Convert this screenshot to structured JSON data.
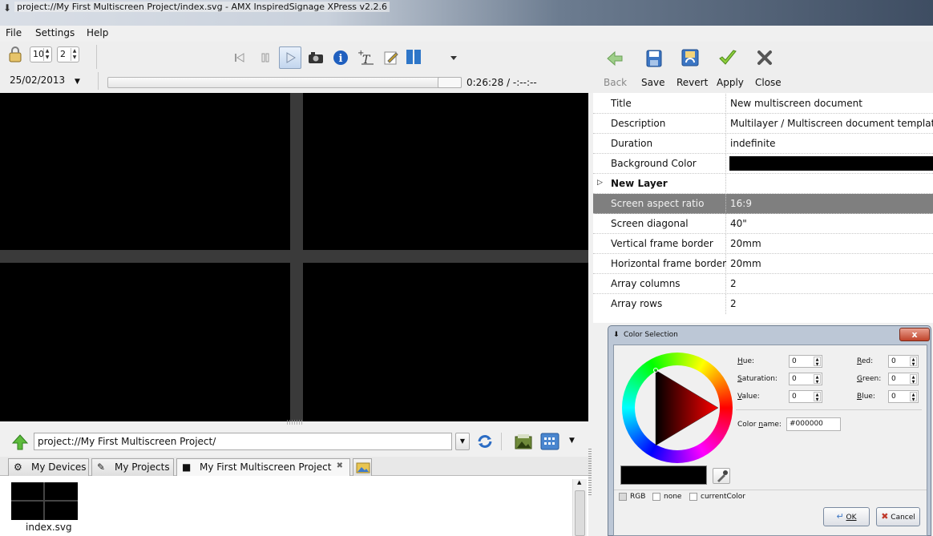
{
  "window": {
    "title": "project://My First Multiscreen Project/index.svg - AMX InspiredSignage XPress v2.2.6"
  },
  "menu": [
    "File",
    "Settings",
    "Help"
  ],
  "toolbar": {
    "columns_value": "10",
    "rows_value": "2",
    "date": "25/02/2013",
    "time_readout": "0:26:28 / -:--:--",
    "playback_progress_percent": 100,
    "icons": [
      "skip-back-icon",
      "pause-icon",
      "play-icon",
      "camera-icon",
      "info-icon",
      "add-text-icon",
      "edit-icon",
      "layout-icon",
      "chevron-down-icon"
    ]
  },
  "right_toolbar": {
    "back_label": "Back",
    "save_label": "Save",
    "revert_label": "Revert",
    "apply_label": "Apply",
    "close_label": "Close"
  },
  "properties": [
    {
      "key": "Title",
      "value": "New multiscreen document"
    },
    {
      "key": "Description",
      "value": "Multilayer / Multiscreen document template"
    },
    {
      "key": "Duration",
      "value": "indefinite"
    },
    {
      "key": "Background Color",
      "value": ""
    },
    {
      "key": "New Layer",
      "value": ""
    },
    {
      "key": "Screen aspect ratio",
      "value": "16:9"
    },
    {
      "key": "Screen diagonal",
      "value": "40\""
    },
    {
      "key": "Vertical frame border",
      "value": "20mm"
    },
    {
      "key": "Horizontal frame border",
      "value": "20mm"
    },
    {
      "key": "Array columns",
      "value": "2"
    },
    {
      "key": "Array rows",
      "value": "2"
    }
  ],
  "colors": {
    "background_color": "#000000",
    "selected_row": "#7f7f7f"
  },
  "path_bar": {
    "path": "project://My First Multiscreen Project/"
  },
  "tabs": [
    "My Devices",
    "My Projects",
    "My First Multiscreen Project"
  ],
  "files": [
    {
      "name": "index.svg"
    }
  ],
  "color_dialog": {
    "title": "Color Selection",
    "close_label": "x",
    "hue_label": "Hue:",
    "hue": "0",
    "saturation_label": "Saturation:",
    "saturation": "0",
    "value_label": "Value:",
    "value": "0",
    "red_label": "Red:",
    "red": "0",
    "green_label": "Green:",
    "green": "0",
    "blue_label": "Blue:",
    "blue": "0",
    "color_name_label": "Color name:",
    "color_name": "#000000",
    "mode_rgb": "RGB",
    "mode_none": "none",
    "mode_current": "currentColor",
    "ok_label": "OK",
    "cancel_label": "Cancel"
  }
}
